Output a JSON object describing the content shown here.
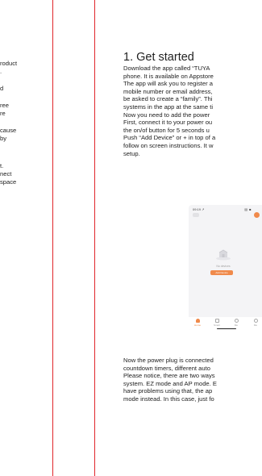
{
  "left_column": {
    "lines": [
      "roduct",
      ".",
      "",
      "d",
      "",
      "ree",
      "re",
      "",
      "cause",
      "by",
      "",
      "",
      "t.",
      "nect",
      "space"
    ]
  },
  "section": {
    "heading": "1. Get started",
    "intro_lines": [
      "Download the app called “TUYA",
      "phone. It is available on Appstore",
      "The app will ask you to register a",
      "mobile number or email address,",
      "be asked to create a “family”. Thi",
      "systems in the app at the same ti",
      "Now you need to add the power",
      "First, connect it to your power ou",
      "the on/of button for 5 seconds u",
      "Push “Add Device” or + in top of a",
      "follow on screen instructions. It w",
      "setup."
    ],
    "followup_lines": [
      "Now the power plug is connected",
      "countdown timers, different auto",
      "Please notice, there are two ways",
      "system. EZ mode and AP mode. E",
      "have problems using that, the ap",
      "mode instead. In this case, just fo"
    ]
  },
  "phone_screen": {
    "status_time": "09:19 ↗",
    "status_right": "▤ ■",
    "empty_message": "No devices",
    "add_button": "Add Device",
    "tabs": [
      {
        "label": "Home",
        "icon": "home-icon"
      },
      {
        "label": "Smart",
        "icon": "smart-icon"
      },
      {
        "label": "Me",
        "icon": "profile-icon"
      },
      {
        "label": "Me",
        "icon": "profile-icon"
      }
    ]
  },
  "colors": {
    "margin_line": "#e0262b",
    "accent": "#f08a4b"
  }
}
